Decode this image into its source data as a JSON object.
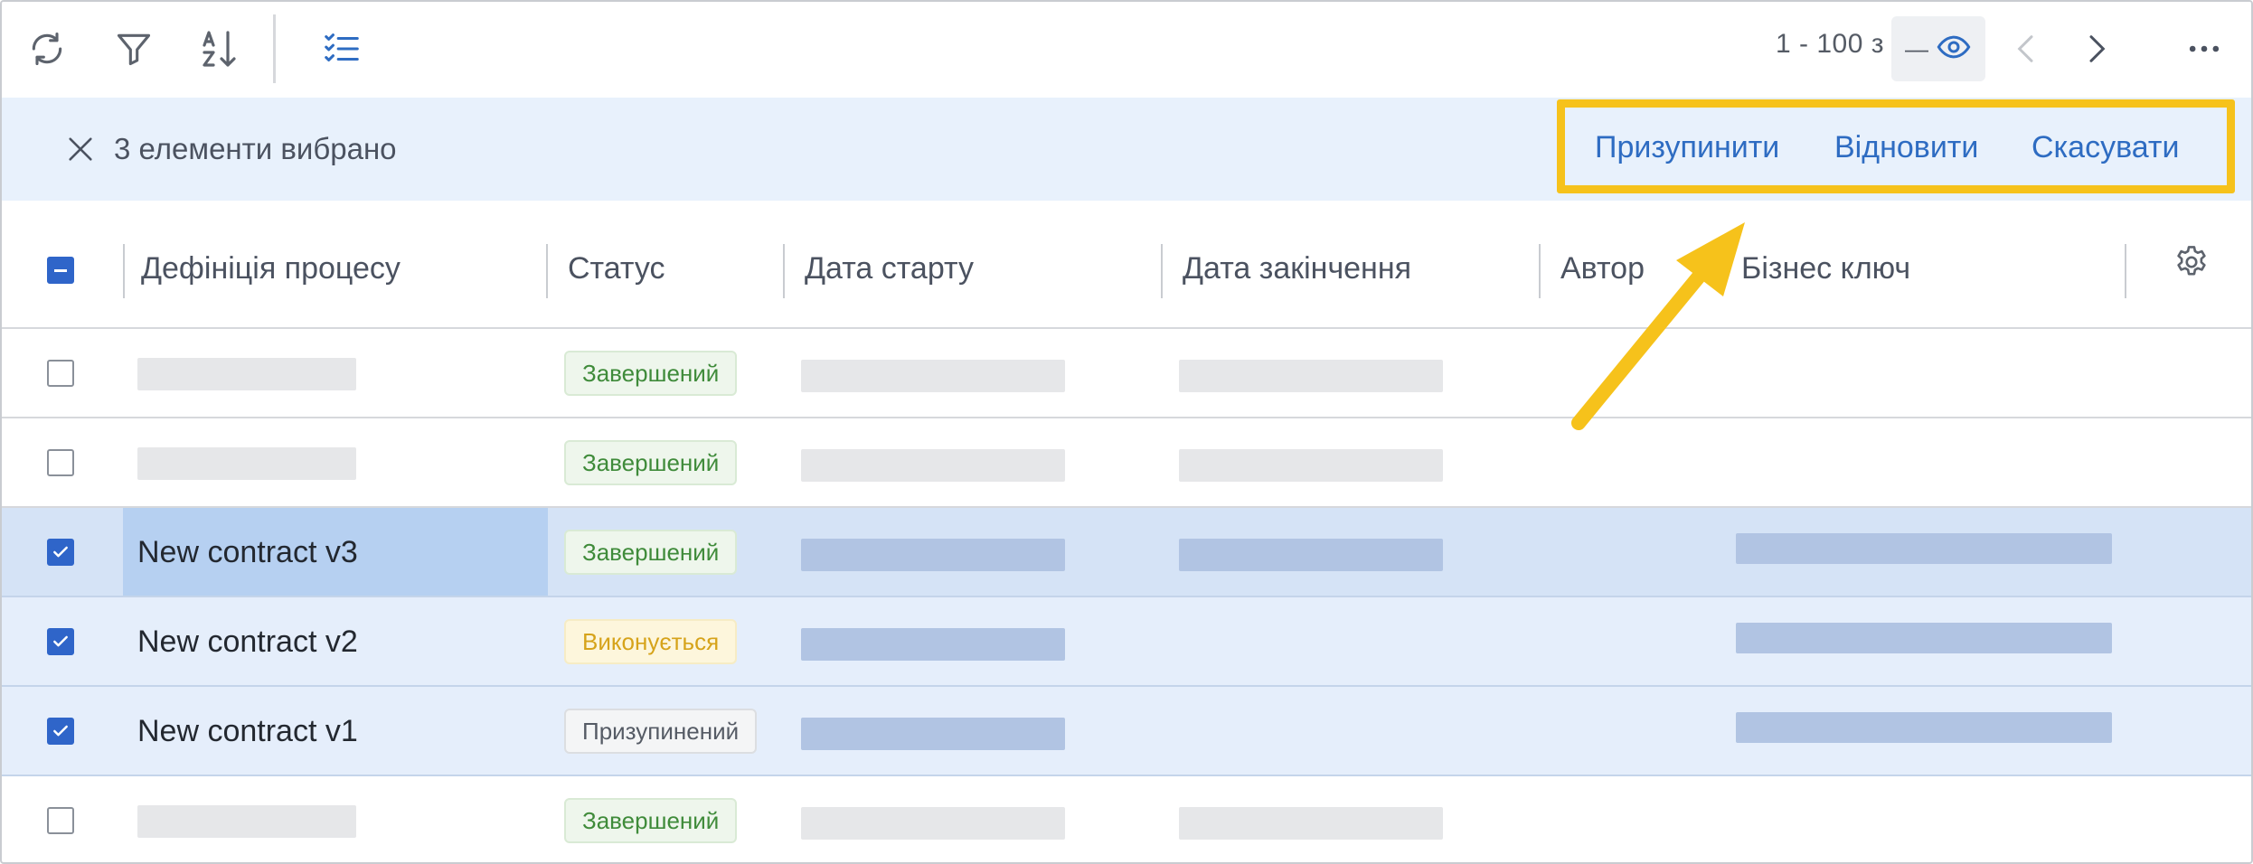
{
  "toolbar": {
    "refresh_icon": "refresh-icon",
    "filter_icon": "filter-icon",
    "sort_icon": "sort-az-icon",
    "checklist_icon": "checklist-icon",
    "pager_text": "1 - 100 з",
    "pager_total": "—",
    "pager_eye_icon": "eye-icon",
    "prev_icon": "chevron-left-icon",
    "next_icon": "chevron-right-icon",
    "more_icon": "more-horizontal-icon"
  },
  "selection": {
    "count_label": "3 елементи вибрано",
    "actions": [
      {
        "label": "Призупинити"
      },
      {
        "label": "Відновити"
      },
      {
        "label": "Скасувати"
      }
    ]
  },
  "table": {
    "columns": [
      {
        "label": "Дефініція процесу"
      },
      {
        "label": "Статус"
      },
      {
        "label": "Дата старту"
      },
      {
        "label": "Дата закінчення"
      },
      {
        "label": "Автор"
      },
      {
        "label": "Бізнес ключ"
      }
    ],
    "rows": [
      {
        "name": "",
        "status": "Завершений",
        "selected": false
      },
      {
        "name": "",
        "status": "Завершений",
        "selected": false
      },
      {
        "name": "New contract v3",
        "status": "Завершений",
        "selected": true
      },
      {
        "name": "New contract v2",
        "status": "Виконується",
        "selected": true
      },
      {
        "name": "New contract v1",
        "status": "Призупинений",
        "selected": true
      },
      {
        "name": "",
        "status": "Завершений",
        "selected": false
      }
    ]
  },
  "colors": {
    "accent": "#2f65c9",
    "link": "#2e6cc2",
    "highlight": "#f6c21b",
    "selection_bg": "#e8f1fc"
  }
}
